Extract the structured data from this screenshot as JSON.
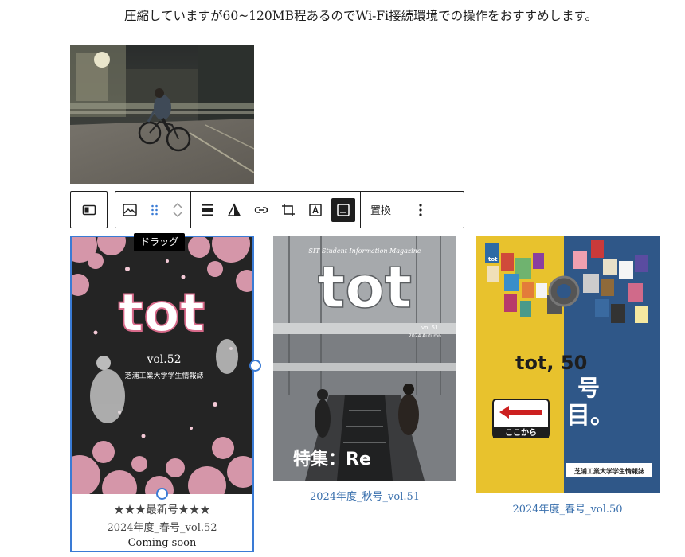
{
  "intro_text": "圧縮していますが60~120MB程あるのでWi-Fi接続環境での操作をおすすめします。",
  "toolbar": {
    "tooltip": "ドラッグ",
    "replace_label": "置換"
  },
  "gallery": [
    {
      "cover": {
        "brand": "tot",
        "volume": "vol.52",
        "subtitle": "芝浦工業大学学生情報誌"
      },
      "badge": "★★★最新号★★★",
      "title": "2024年度_春号_vol.52",
      "status": "Coming soon"
    },
    {
      "cover": {
        "magazine": "SIT Student Information Magazine",
        "brand": "tot",
        "volume": "vol.51",
        "season": "2024 Autumn",
        "feature": "特集：Re"
      },
      "title": "2024年度_秋号_vol.51"
    },
    {
      "cover": {
        "headline_1": "tot, 50",
        "headline_2": "号",
        "headline_3": "目。",
        "sign": "ここから",
        "footer": "芝浦工業大学学生情報誌",
        "mini_tile": "tot"
      },
      "title": "2024年度_春号_vol.50"
    }
  ],
  "colors": {
    "accent": "#3a7bd5",
    "link": "#3a70ad",
    "yellow": "#e8c22d",
    "navy": "#2f5788",
    "petal": "#e9a3b8"
  }
}
